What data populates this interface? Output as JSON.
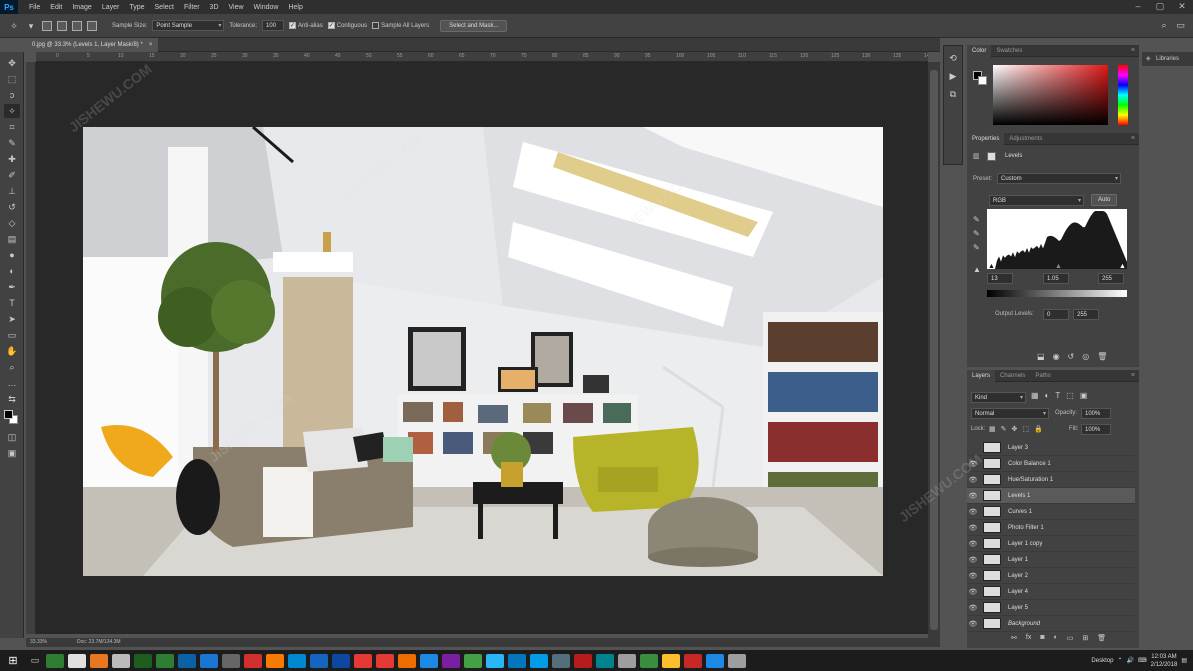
{
  "menubar": {
    "logo": "Ps",
    "items": [
      "File",
      "Edit",
      "Image",
      "Layer",
      "Type",
      "Select",
      "Filter",
      "3D",
      "View",
      "Window",
      "Help"
    ]
  },
  "options": {
    "sample_size_label": "Sample Size:",
    "sample_size_value": "Point Sample",
    "tolerance_label": "Tolerance:",
    "tolerance_value": "100",
    "anti_alias": "Anti-alias",
    "contiguous": "Contiguous",
    "sample_all_layers": "Sample All Layers",
    "select_mask_button": "Select and Mask..."
  },
  "document": {
    "tab_title": "0.jpg @ 33.3% (Levels 1, Layer Mask/8) *",
    "close": "×",
    "status_zoom": "33.33%",
    "status_doc": "Doc: 23.7M/134.3M"
  },
  "ruler_ticks": [
    "0",
    "5",
    "10",
    "15",
    "20",
    "25",
    "30",
    "35",
    "40",
    "45",
    "50",
    "55",
    "60",
    "65",
    "70",
    "75",
    "80",
    "85",
    "90",
    "95",
    "100",
    "105",
    "110",
    "115",
    "120",
    "125",
    "130",
    "135",
    "140"
  ],
  "color_panel": {
    "tabs": [
      "Color",
      "Swatches"
    ]
  },
  "properties_panel": {
    "tabs": [
      "Properties",
      "Adjustments"
    ],
    "title": "Levels",
    "preset_label": "Preset:",
    "preset_value": "Custom",
    "channel": "RGB",
    "auto_button": "Auto",
    "input_black": "13",
    "input_gamma": "1.05",
    "input_white": "255",
    "output_label": "Output Levels:",
    "output_black": "0",
    "output_white": "255"
  },
  "layers_panel": {
    "tabs": [
      "Layers",
      "Channels",
      "Paths"
    ],
    "kind_filter": "Kind",
    "blend_mode": "Normal",
    "opacity_label": "Opacity:",
    "opacity_value": "100%",
    "lock_label": "Lock:",
    "fill_label": "Fill:",
    "fill_value": "100%",
    "layers": [
      {
        "name": "Layer 3",
        "visible": false
      },
      {
        "name": "Color Balance 1",
        "visible": true
      },
      {
        "name": "Hue/Saturation 1",
        "visible": true
      },
      {
        "name": "Levels 1",
        "visible": true,
        "selected": true
      },
      {
        "name": "Curves 1",
        "visible": true
      },
      {
        "name": "Photo Filter 1",
        "visible": true
      },
      {
        "name": "Layer 1 copy",
        "visible": true
      },
      {
        "name": "Layer 1",
        "visible": true
      },
      {
        "name": "Layer 2",
        "visible": true
      },
      {
        "name": "Layer 4",
        "visible": true
      },
      {
        "name": "Layer 5",
        "visible": true
      },
      {
        "name": "Background",
        "visible": true
      }
    ]
  },
  "libraries": {
    "label": "Libraries"
  },
  "taskbar": {
    "desktop_label": "Desktop",
    "time": "12:03 AM",
    "date": "2/12/2018",
    "icon_colors": [
      "#2f7d32",
      "#e0e0e0",
      "#e87722",
      "#bbbbbb",
      "#1b5e20",
      "#2e7d32",
      "#0b61a4",
      "#1976d2",
      "#666666",
      "#d32f2f",
      "#f57c00",
      "#0288d1",
      "#1565c0",
      "#0d47a1",
      "#e53935",
      "#e53935",
      "#ef6c00",
      "#1e88e5",
      "#7b1fa2",
      "#43a047",
      "#29b6f6",
      "#0277bd",
      "#039be5",
      "#546e7a",
      "#b71c1c",
      "#00838f",
      "#9e9e9e",
      "#388e3c",
      "#fbc02d",
      "#c62828",
      "#1e88e5",
      "#9e9e9e"
    ]
  },
  "watermark": {
    "text": "JISHEWU.COM"
  }
}
